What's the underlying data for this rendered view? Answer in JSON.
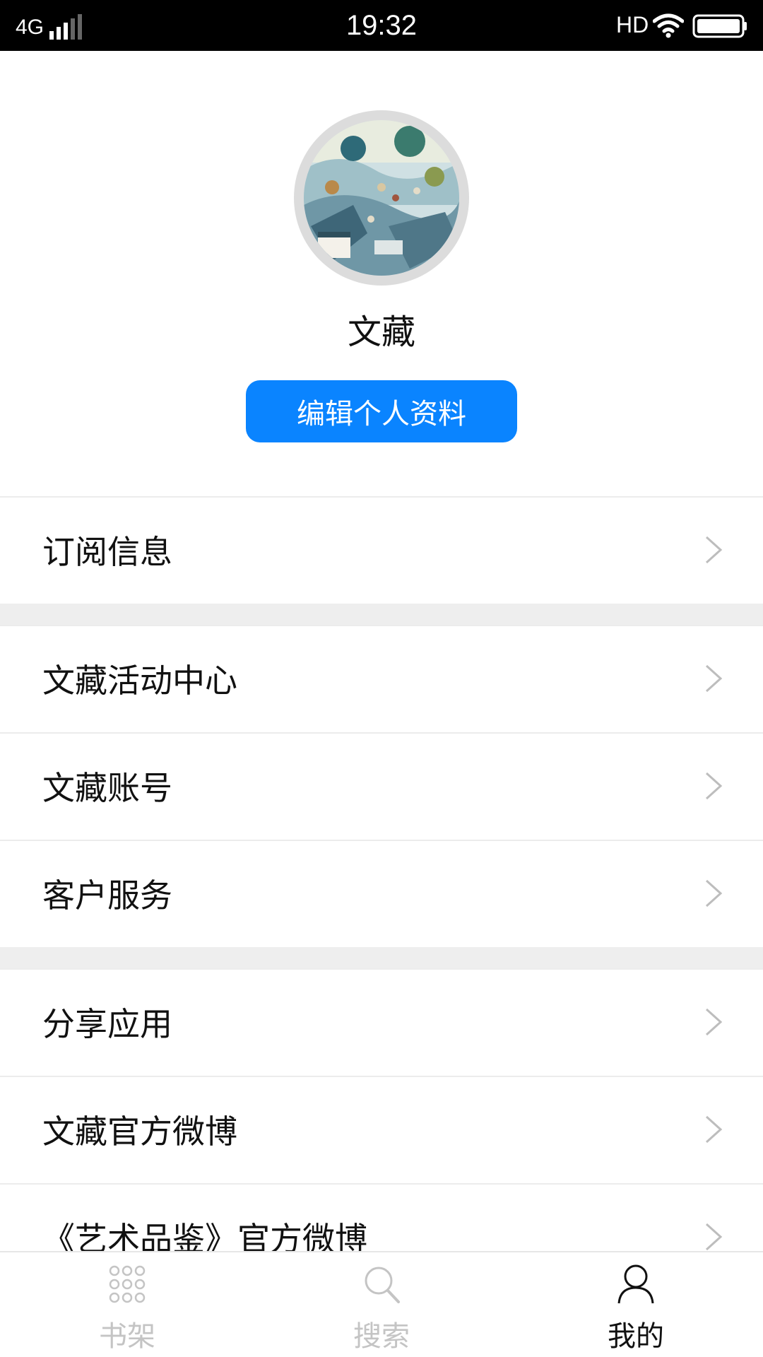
{
  "status_bar": {
    "carrier": "4G",
    "time": "19:32",
    "hd": "HD",
    "icons": [
      "signal-icon",
      "wifi-icon",
      "battery-icon"
    ]
  },
  "profile": {
    "avatar": "landscape-painting-avatar",
    "username": "文藏",
    "edit_button": "编辑个人资料"
  },
  "menu": {
    "items": [
      {
        "label": "订阅信息"
      },
      {
        "label": "文藏活动中心"
      },
      {
        "label": "文藏账号"
      },
      {
        "label": "客户服务"
      },
      {
        "label": "分享应用"
      },
      {
        "label": "文藏官方微博"
      },
      {
        "label": "《艺术品鉴》官方微博"
      }
    ]
  },
  "tab_bar": {
    "tabs": [
      {
        "label": "书架",
        "icon": "grid-icon",
        "active": false
      },
      {
        "label": "搜索",
        "icon": "search-icon",
        "active": false
      },
      {
        "label": "我的",
        "icon": "person-icon",
        "active": true
      }
    ]
  },
  "colors": {
    "accent": "#0a84ff",
    "active_tab": "#111111",
    "inactive_tab": "#c4c4c4",
    "divider": "#eeeeee"
  }
}
